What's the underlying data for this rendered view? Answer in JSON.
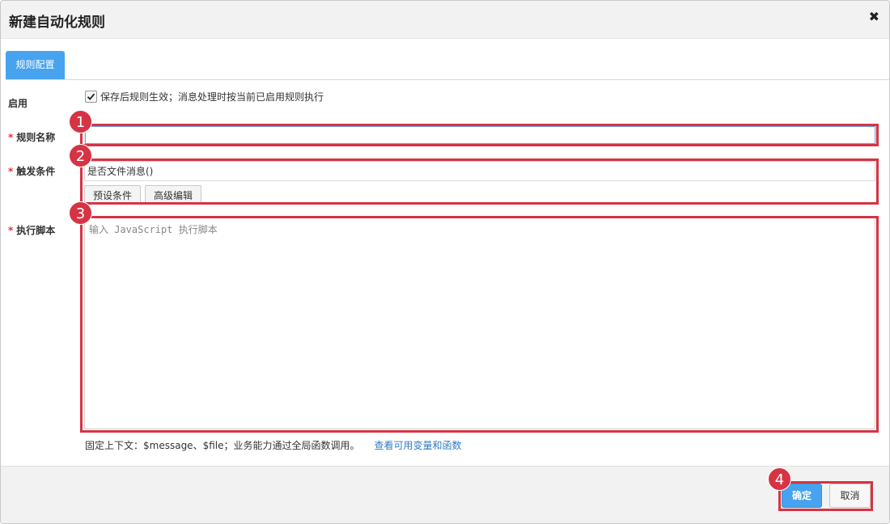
{
  "dialog": {
    "title": "新建自动化规则",
    "close_symbol": "✖",
    "tab_label": "规则配置"
  },
  "form": {
    "enable_label": "启用",
    "enable_checked": true,
    "enable_text": "保存后规则生效；消息处理时按当前已启用规则执行",
    "required_mark": "*",
    "name_label": "规则名称",
    "name_value": "",
    "trigger_label": "触发条件",
    "trigger_value": "是否文件消息()",
    "preset_button": "预设条件",
    "advanced_button": "高级编辑",
    "script_label": "执行脚本",
    "script_placeholder": "输入 JavaScript 执行脚本",
    "help_text": "固定上下文：$message、$file；业务能力通过全局函数调用。",
    "help_link": "查看可用变量和函数"
  },
  "footer": {
    "confirm_label": "确定",
    "cancel_label": "取消"
  },
  "annotations": {
    "markers": [
      "1",
      "2",
      "3",
      "4"
    ],
    "color": "#d63344"
  },
  "colors": {
    "accent": "#47a3ee",
    "link": "#2f7bc4",
    "required": "#d9363e"
  }
}
